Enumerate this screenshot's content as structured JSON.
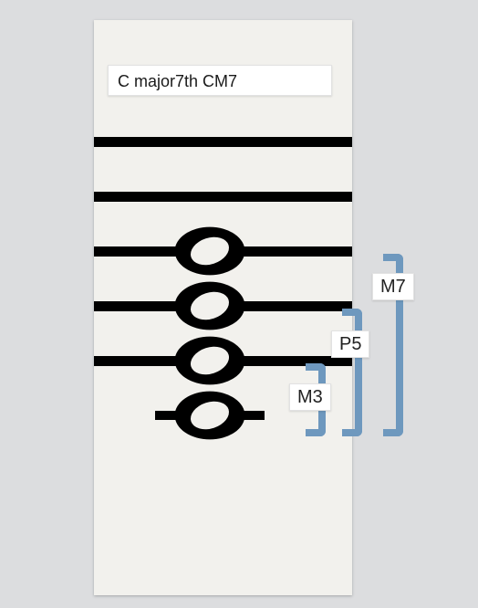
{
  "title": "C major7th CM7",
  "intervals": {
    "third": {
      "label": "M3"
    },
    "fifth": {
      "label": "P5"
    },
    "seventh": {
      "label": "M7"
    }
  },
  "chord": {
    "root": "C",
    "quality": "major7th",
    "symbol": "CM7",
    "notes": [
      "C",
      "E",
      "G",
      "B"
    ]
  },
  "colors": {
    "bracket": "#6e98be",
    "page_bg": "#dcdddf",
    "card_bg": "#f2f1ed"
  }
}
